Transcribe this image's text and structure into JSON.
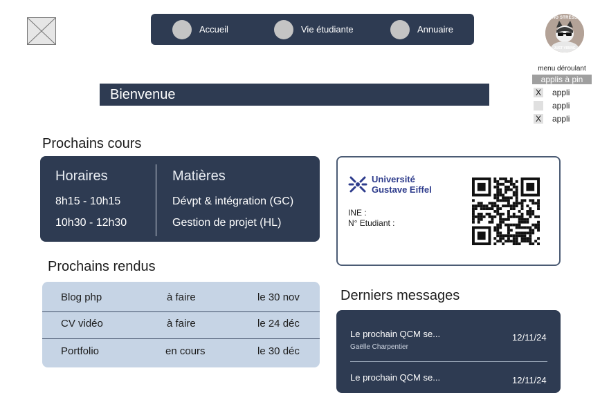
{
  "nav": {
    "items": [
      {
        "label": "Accueil"
      },
      {
        "label": "Vie étudiante"
      },
      {
        "label": "Annuaire"
      }
    ]
  },
  "avatar": {
    "top_text": "NO STRESS",
    "bottom_text": "JUST VIBING"
  },
  "menu": {
    "label": "menu déroulant",
    "pin_label": "applis à pin",
    "items": [
      {
        "mark": "X",
        "label": "appli"
      },
      {
        "mark": "",
        "label": "appli"
      },
      {
        "mark": "X",
        "label": "appli"
      }
    ]
  },
  "banner": {
    "title": "Bienvenue"
  },
  "courses": {
    "title": "Prochains cours",
    "col_hours": "Horaires",
    "col_subjects": "Matières",
    "rows": [
      {
        "time": "8h15 - 10h15",
        "subject": "Dévpt & intégration (GC)"
      },
      {
        "time": "10h30 - 12h30",
        "subject": "Gestion de projet (HL)"
      }
    ]
  },
  "rendus": {
    "title": "Prochains rendus",
    "rows": [
      {
        "name": "Blog php",
        "status": "à faire",
        "due": "le 30 nov"
      },
      {
        "name": "CV vidéo",
        "status": "à faire",
        "due": "le 24 déc"
      },
      {
        "name": "Portfolio",
        "status": "en cours",
        "due": "le 30 déc"
      }
    ]
  },
  "card": {
    "university_line1": "Université",
    "university_line2": "Gustave Eiffel",
    "ine_label": "INE :",
    "student_no_label": "N° Etudiant :"
  },
  "messages": {
    "title": "Derniers messages",
    "items": [
      {
        "text": "Le prochain QCM se...",
        "author": "Gaëlle Charpentier",
        "date": "12/11/24"
      },
      {
        "text": "Le prochain QCM se...",
        "author": "",
        "date": "12/11/24"
      }
    ]
  },
  "colors": {
    "primary": "#2e3b52",
    "light_panel": "#c6d4e5",
    "brand": "#2e3c8c"
  }
}
